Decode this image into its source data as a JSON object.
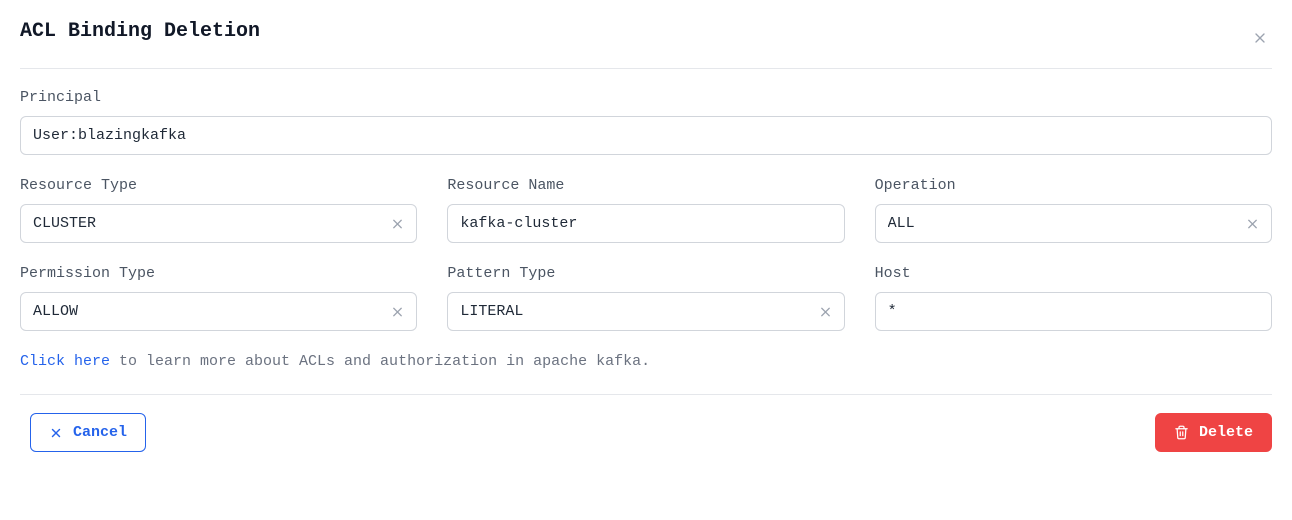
{
  "dialog": {
    "title": "ACL Binding Deletion"
  },
  "fields": {
    "principal": {
      "label": "Principal",
      "value": "User:blazingkafka"
    },
    "resourceType": {
      "label": "Resource Type",
      "value": "CLUSTER"
    },
    "resourceName": {
      "label": "Resource Name",
      "value": "kafka-cluster"
    },
    "operation": {
      "label": "Operation",
      "value": "ALL"
    },
    "permissionType": {
      "label": "Permission Type",
      "value": "ALLOW"
    },
    "patternType": {
      "label": "Pattern Type",
      "value": "LITERAL"
    },
    "host": {
      "label": "Host",
      "value": "*"
    }
  },
  "info": {
    "link_text": "Click here",
    "rest": " to learn more about ACLs and authorization in apache kafka."
  },
  "buttons": {
    "cancel": "Cancel",
    "delete": "Delete"
  }
}
